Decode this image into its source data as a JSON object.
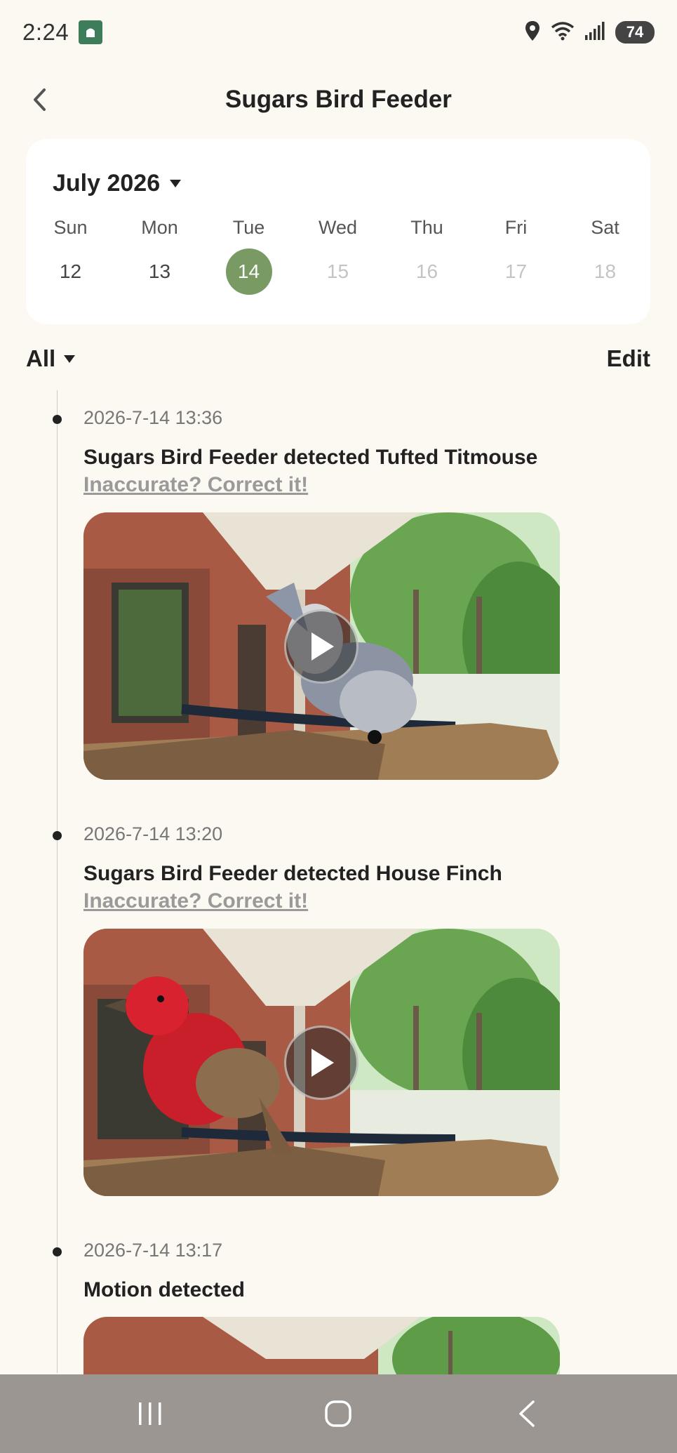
{
  "status_bar": {
    "time": "2:24",
    "battery": "74"
  },
  "header": {
    "title": "Sugars Bird Feeder"
  },
  "calendar": {
    "month_label": "July 2026",
    "day_names": [
      "Sun",
      "Mon",
      "Tue",
      "Wed",
      "Thu",
      "Fri",
      "Sat"
    ],
    "dates": [
      "12",
      "13",
      "14",
      "15",
      "16",
      "17",
      "18"
    ],
    "selected_date": "14",
    "accent_color": "#7a9a64"
  },
  "filter": {
    "label": "All",
    "edit_label": "Edit"
  },
  "events": [
    {
      "time": "2026-7-14 13:36",
      "text": "Sugars Bird Feeder detected Tufted Titmouse",
      "link": "Inaccurate? Correct it!"
    },
    {
      "time": "2026-7-14 13:20",
      "text": "Sugars Bird Feeder detected House Finch",
      "link": "Inaccurate? Correct it!"
    },
    {
      "time": "2026-7-14 13:17",
      "text": "Motion detected"
    }
  ]
}
